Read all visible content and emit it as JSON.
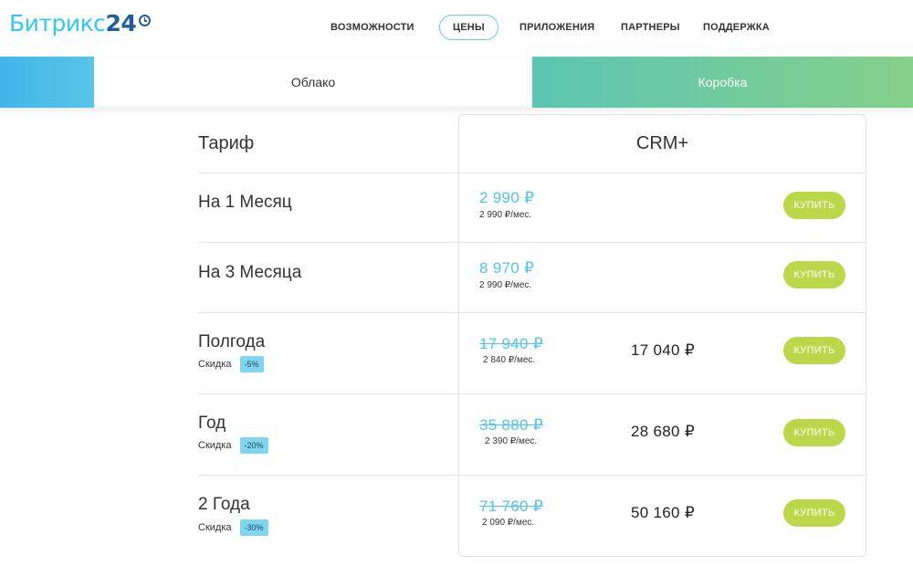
{
  "header": {
    "logo_text": "Битрикс",
    "logo_num": "24",
    "nav": [
      {
        "label": "ВОЗМОЖНОСТИ"
      },
      {
        "label": "ЦЕНЫ",
        "active": true
      },
      {
        "label": "ПРИЛОЖЕНИЯ"
      },
      {
        "label": "ПАРТНЕРЫ"
      },
      {
        "label": "ПОДДЕРЖКА"
      }
    ]
  },
  "tabs": {
    "cloud": "Облако",
    "box": "Коробка"
  },
  "table": {
    "label_header": "Тариф",
    "plan_header": "CRM+",
    "buy_label": "КУПИТЬ",
    "discount_label": "Скидка",
    "rows": [
      {
        "title": "На 1 Месяц",
        "price": "2 990 ₽",
        "per_month": "2 990 ₽/мес."
      },
      {
        "title": "На 3 Месяца",
        "price": "8 970 ₽",
        "per_month": "2 990 ₽/мес."
      },
      {
        "title": "Полгода",
        "discount": "-5%",
        "old_price": "17 940 ₽",
        "per_month": "2 840 ₽/мес.",
        "final_price": "17 040 ₽"
      },
      {
        "title": "Год",
        "discount": "-20%",
        "old_price": "35 880 ₽",
        "per_month": "2 390 ₽/мес.",
        "final_price": "28 680 ₽"
      },
      {
        "title": "2 Года",
        "discount": "-30%",
        "old_price": "71 760 ₽",
        "per_month": "2 090 ₽/мес.",
        "final_price": "50 160 ₽"
      }
    ]
  },
  "colors": {
    "brand_blue": "#2fc7f7",
    "brand_dark": "#215f98",
    "price_blue": "#52c4ec",
    "buy_green": "#bbd84b",
    "badge_blue": "#7fd6f2"
  }
}
